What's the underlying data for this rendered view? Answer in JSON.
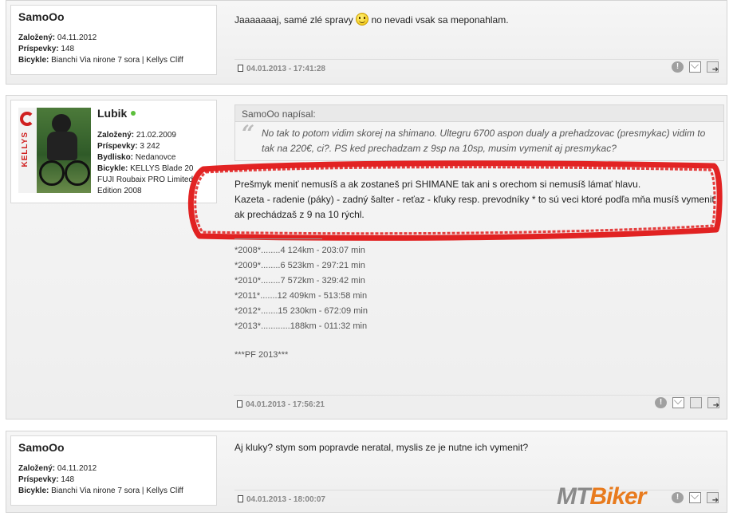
{
  "posts": [
    {
      "username": "SamoOo",
      "joined_label": "Založený:",
      "joined": "04.11.2012",
      "posts_label": "Príspevky:",
      "posts_count": "148",
      "bikes_label": "Bicykle:",
      "bikes": "Bianchi Via nirone 7 sora | Kellys Cliff",
      "text_before": "Jaaaaaaaj, samé zlé spravy",
      "text_after": "no nevadi vsak sa meponahlam.",
      "date": "04.01.2013 - 17:41:28"
    },
    {
      "username": "Lubik",
      "joined_label": "Založený:",
      "joined": "21.02.2009",
      "posts_label": "Príspevky:",
      "posts_count": "3 242",
      "location_label": "Bydlisko:",
      "location": "Nedanovce",
      "bikes_label": "Bicykle:",
      "bikes_line1": "KELLYS Blade 20",
      "bikes_line2": "FUJI Roubaix PRO Limited",
      "bikes_line3": "Edition 2008",
      "avatar_brand": "KELLYS",
      "quote_header": "SamoOo napísal:",
      "quote_line1": "No tak to potom vidim skorej na shimano. Ultegru 6700 aspon dualy a prehadzovac (presmykac) vidim to",
      "quote_line2": "tak na 220€, ci?. PS ked prechadzam z 9sp na 10sp, musim vymenit aj presmykac?",
      "reply_line1": "Prešmyk meniť nemusíš a ak zostaneš pri SHIMANE tak ani s orechom si nemusíš lámať hlavu.",
      "reply_line2": "Kazeta - radenie (páky) - zadný šalter - reťaz - kľuky resp. prevodníky * to sú veci ktoré podľa mňa musíš vymeniť",
      "reply_line3": "ak prechádzaš z 9 na 10 rýchl.",
      "signature": [
        "*2008*........4 124km - 203:07 min",
        "*2009*........6 523km - 297:21 min",
        "*2010*........7 572km - 329:42 min",
        "*2011*.......12 409km - 513:58 min",
        "*2012*.......15 230km - 672:09 min",
        "*2013*............188km - 011:32 min"
      ],
      "signature_footer": "***PF 2013***",
      "date": "04.01.2013 - 17:56:21"
    },
    {
      "username": "SamoOo",
      "joined_label": "Založený:",
      "joined": "04.11.2012",
      "posts_label": "Príspevky:",
      "posts_count": "148",
      "bikes_label": "Bicykle:",
      "bikes": "Bianchi Via nirone 7 sora | Kellys Cliff",
      "text": "Aj kluky? stym som popravde neratal, myslis ze je nutne ich vymenit?",
      "date": "04.01.2013 - 18:00:07"
    }
  ],
  "watermark": {
    "part1": "MT",
    "part2": "Biker"
  },
  "colors": {
    "highlight": "#e01010",
    "online": "#5cbf3c",
    "watermark_accent": "#e87b1e"
  },
  "icons": {
    "report": "!",
    "quote_arrow": "➜"
  }
}
